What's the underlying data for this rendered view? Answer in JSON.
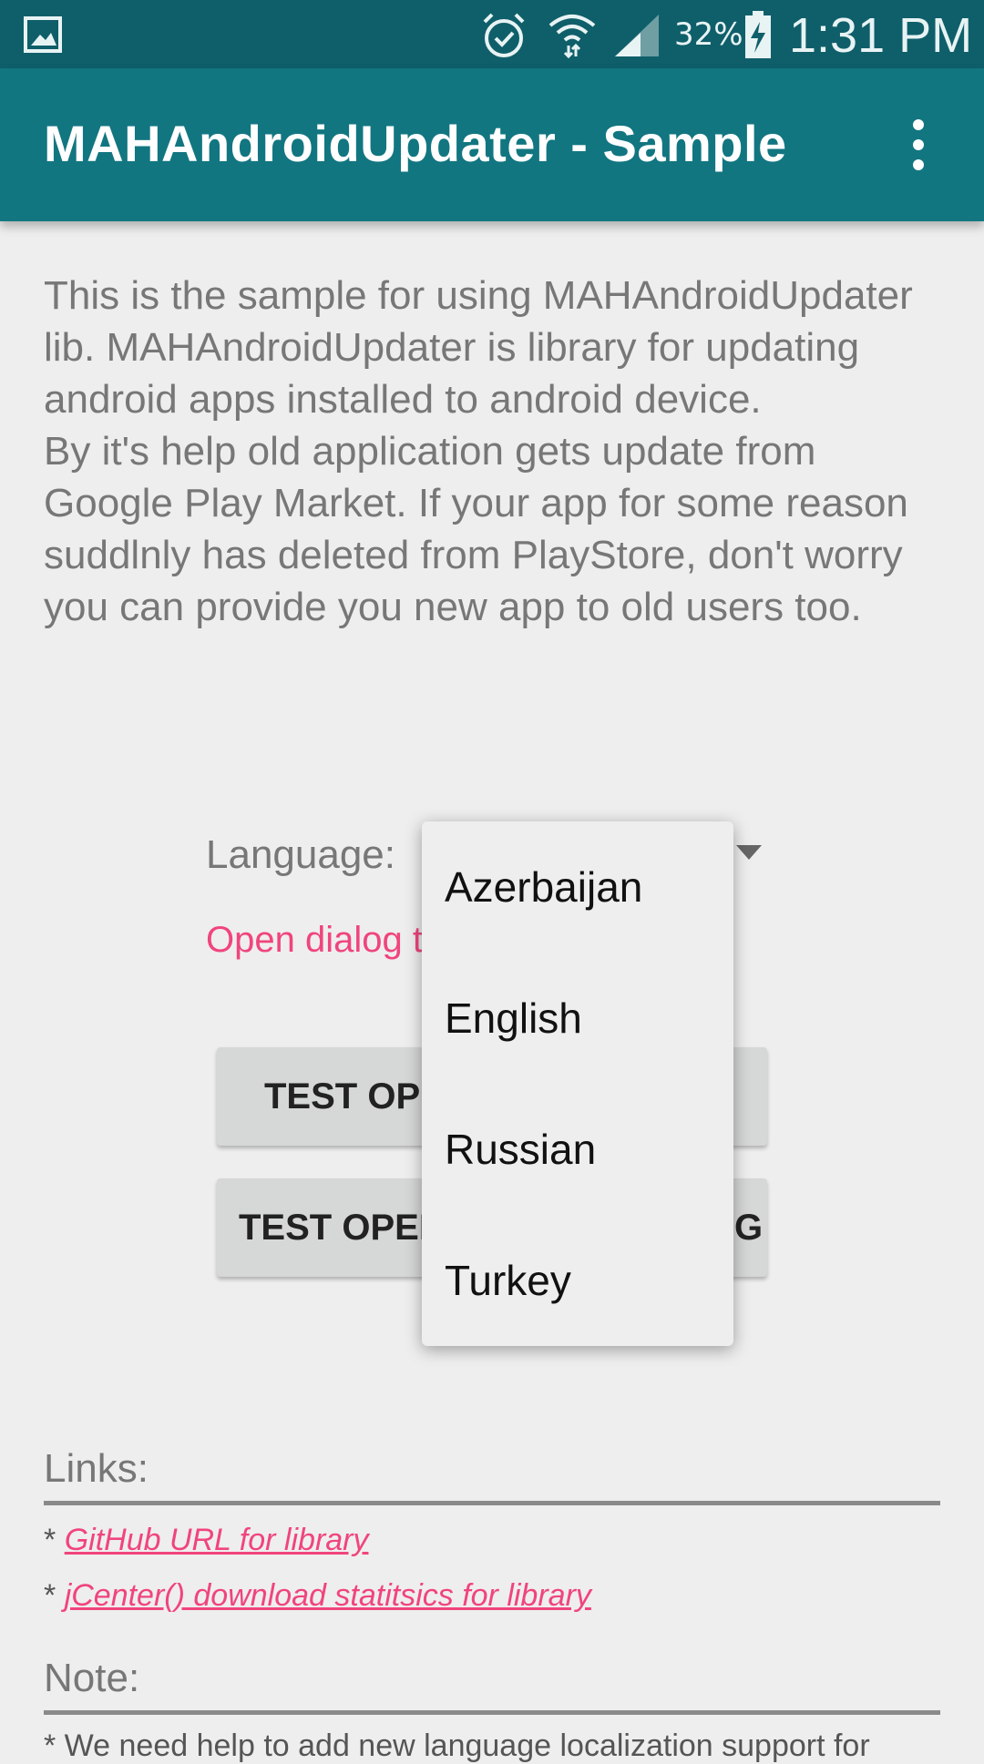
{
  "status_bar": {
    "battery_percent": "32%",
    "time": "1:31 PM",
    "icons": [
      "gallery-icon",
      "alarm-icon",
      "wifi-icon",
      "signal-icon",
      "battery-charging-icon"
    ]
  },
  "app_bar": {
    "title": "MAHAndroidUpdater - Sample",
    "overflow_icon": "more-vert-icon"
  },
  "description": {
    "paragraph1": "This is the sample for using MAHAndroidUpdater lib. MAHAndroidUpdater is library for updating android apps installed to android device.",
    "paragraph2": "By it's help old application gets update from Google Play Market. If your app for some reason suddlnly has deleted from PlayStore, don't worry you can provide you new app to old users too."
  },
  "language": {
    "label": "Language:",
    "open_dialog_text": "Open dialog to                   g",
    "dropdown_options": [
      "Azerbaijan",
      "English",
      "Russian",
      "Turkey"
    ]
  },
  "buttons": {
    "test_open_1": "TEST OPE",
    "test_open_2": "TEST OPEN",
    "test_open_2_tail": "G"
  },
  "links": {
    "title": "Links:",
    "items": [
      {
        "prefix": "* ",
        "text": "GitHub URL for library"
      },
      {
        "prefix": "* ",
        "text": "jCenter() download statitsics for library"
      }
    ]
  },
  "note": {
    "title": "Note:",
    "text": "* We need help to add new language localization support for"
  },
  "colors": {
    "status_bar": "#0f5f6a",
    "app_bar": "#127681",
    "accent": "#f0457c",
    "background": "#eeeeee"
  }
}
